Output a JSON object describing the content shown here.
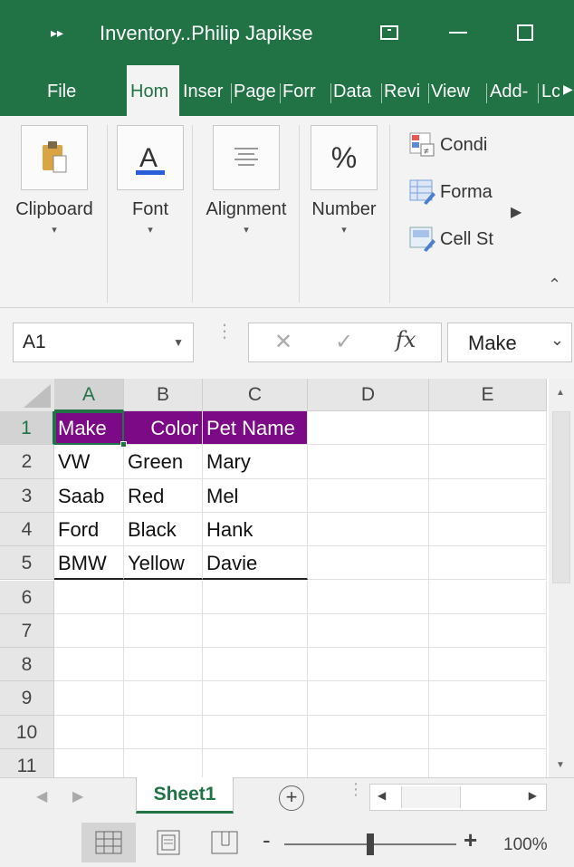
{
  "titlebar": {
    "title": "Inventory..Philip Japikse",
    "qat_glyph": "▸▸"
  },
  "tabs": [
    "File",
    "Hom",
    "Inser",
    "Page",
    "Forr",
    "Data",
    "Revi",
    "View",
    "Add-",
    "Lc"
  ],
  "ribbon": {
    "groups": [
      {
        "label": "Clipboard",
        "icon": "clipboard-icon"
      },
      {
        "label": "Font",
        "icon": "font-color-icon",
        "glyph": "A"
      },
      {
        "label": "Alignment",
        "icon": "align-icon"
      },
      {
        "label": "Number",
        "icon": "percent-icon",
        "glyph": "%"
      }
    ],
    "styles": [
      "Condi",
      "Forma",
      "Cell St"
    ],
    "dropdown_glyph": "▾"
  },
  "formula_bar": {
    "name_box": "A1",
    "fx_label": "fx",
    "cancel_glyph": "✕",
    "enter_glyph": "✓",
    "value": "Make"
  },
  "grid": {
    "columns": [
      "A",
      "B",
      "C",
      "D",
      "E"
    ],
    "rows": [
      "1",
      "2",
      "3",
      "4",
      "5",
      "6",
      "7",
      "8",
      "9",
      "10",
      "11"
    ],
    "selected_cell": "A1",
    "header_color": "#7c0a86",
    "data": [
      [
        "Make",
        "Color",
        "Pet Name"
      ],
      [
        "VW",
        "Green",
        "Mary"
      ],
      [
        "Saab",
        "Red",
        "Mel"
      ],
      [
        "Ford",
        "Black",
        "Hank"
      ],
      [
        "BMW",
        "Yellow",
        "Davie"
      ]
    ]
  },
  "sheets": {
    "tabs": [
      "Sheet1"
    ],
    "add_glyph": "+"
  },
  "status": {
    "zoom": "100%",
    "zoom_fraction": 0.5
  },
  "colors": {
    "accent": "#217346",
    "table_header": "#7c0a86"
  }
}
